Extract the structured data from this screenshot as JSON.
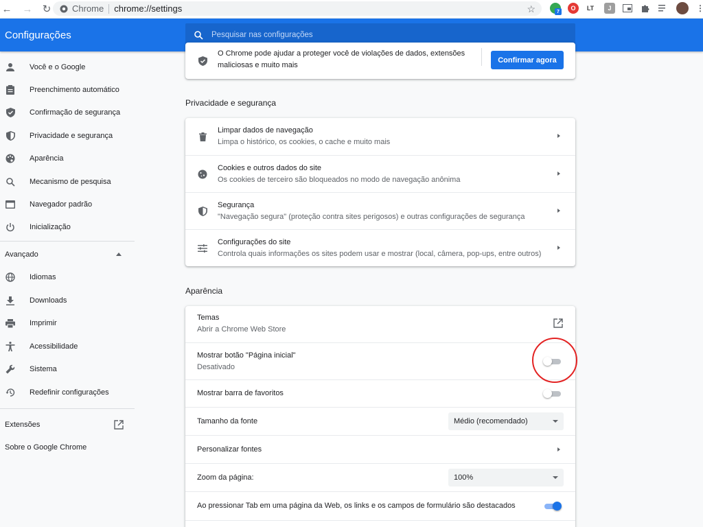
{
  "browser": {
    "tab_site": "Chrome",
    "url": "chrome://settings",
    "extensions": [
      {
        "icon": "green-extension-icon",
        "badge": "7",
        "color": "#34a853"
      },
      {
        "icon": "opera-extension-icon",
        "color": "#e53935"
      },
      {
        "icon": "lt-extension-icon",
        "label": "LT",
        "color": "#3b3b3b"
      },
      {
        "icon": "j-extension-icon",
        "label": "J",
        "color": "#9e9e9e"
      },
      {
        "icon": "picture-in-picture-icon"
      },
      {
        "icon": "puzzle-extensions-icon"
      },
      {
        "icon": "reading-list-icon"
      },
      {
        "icon": "profile-avatar-icon"
      }
    ]
  },
  "header": {
    "title": "Configurações",
    "search_placeholder": "Pesquisar nas configurações"
  },
  "sidebar": {
    "items": [
      {
        "label": "Você e o Google",
        "icon": "person-icon"
      },
      {
        "label": "Preenchimento automático",
        "icon": "clipboard-icon"
      },
      {
        "label": "Confirmação de segurança",
        "icon": "shield-check-icon"
      },
      {
        "label": "Privacidade e segurança",
        "icon": "shield-icon"
      },
      {
        "label": "Aparência",
        "icon": "palette-icon"
      },
      {
        "label": "Mecanismo de pesquisa",
        "icon": "search-icon"
      },
      {
        "label": "Navegador padrão",
        "icon": "browser-icon"
      },
      {
        "label": "Inicialização",
        "icon": "power-icon"
      }
    ],
    "advanced_label": "Avançado",
    "advanced_items": [
      {
        "label": "Idiomas",
        "icon": "globe-icon"
      },
      {
        "label": "Downloads",
        "icon": "download-icon"
      },
      {
        "label": "Imprimir",
        "icon": "printer-icon"
      },
      {
        "label": "Acessibilidade",
        "icon": "accessibility-icon"
      },
      {
        "label": "Sistema",
        "icon": "wrench-icon"
      },
      {
        "label": "Redefinir configurações",
        "icon": "history-icon"
      }
    ],
    "extensions_label": "Extensões",
    "about_label": "Sobre o Google Chrome"
  },
  "safety_card": {
    "text_line1": "O Chrome pode ajudar a proteger você de violações de dados, extensões",
    "text_line2": "maliciosas e muito mais",
    "button_label": "Confirmar agora"
  },
  "privacy": {
    "title": "Privacidade e segurança",
    "rows": [
      {
        "title": "Limpar dados de navegação",
        "subtitle": "Limpa o histórico, os cookies, o cache e muito mais",
        "icon": "trash-icon"
      },
      {
        "title": "Cookies e outros dados do site",
        "subtitle": "Os cookies de terceiro são bloqueados no modo de navegação anônima",
        "icon": "cookie-icon"
      },
      {
        "title": "Segurança",
        "subtitle": "\"Navegação segura\" (proteção contra sites perigosos) e outras configurações de segurança",
        "icon": "shield-icon"
      },
      {
        "title": "Configurações do site",
        "subtitle": "Controla quais informações os sites podem usar e mostrar (local, câmera, pop-ups, entre outros)",
        "icon": "sliders-icon"
      }
    ]
  },
  "appearance": {
    "title": "Aparência",
    "themes_title": "Temas",
    "themes_subtitle": "Abrir a Chrome Web Store",
    "home_button_title": "Mostrar botão \"Página inicial\"",
    "home_button_subtitle": "Desativado",
    "home_button_on": false,
    "bookmarks_bar_title": "Mostrar barra de favoritos",
    "bookmarks_bar_on": false,
    "font_size_label": "Tamanho da fonte",
    "font_size_value": "Médio (recomendado)",
    "customize_fonts_label": "Personalizar fontes",
    "zoom_label": "Zoom da página:",
    "zoom_value": "100%",
    "tab_highlight_label": "Ao pressionar Tab em uma página da Web, os links e os campos de formulário são destacados",
    "tab_highlight_on": true
  },
  "colors": {
    "accent": "#1a73e8",
    "highlight_circle": "#e32222"
  }
}
